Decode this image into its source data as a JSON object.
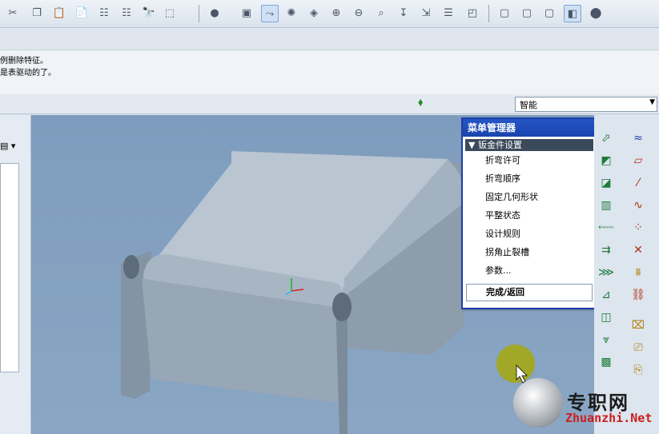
{
  "toolbar": {
    "icons": [
      "cut-icon",
      "copy-icon",
      "paste-icon",
      "paste-special-icon",
      "regenerate-icon",
      "regenerate-manager-icon",
      "find-icon",
      "select-box-icon",
      "shading-icon",
      "view-manager-icon",
      "datum-display-icon",
      "spin-center-icon",
      "orient-icon",
      "zoom-in-icon",
      "zoom-out-icon",
      "refit-icon",
      "reorient-icon",
      "saved-views-icon",
      "layers-icon",
      "appearance-icon",
      "wireframe-icon",
      "hidden-line-icon",
      "no-hidden-icon",
      "shaded-icon",
      "model-tree-icon"
    ]
  },
  "messages": {
    "line1": "例删除特征。",
    "line2": "是表驱动的了。"
  },
  "status": {
    "filter_value": "智能"
  },
  "menu_manager": {
    "title": "菜单管理器",
    "section": "钣金件设置",
    "items": [
      "折弯许可",
      "折弯顺序",
      "固定几何形状",
      "平整状态",
      "设计规则",
      "拐角止裂槽",
      "参数..."
    ],
    "done": "完成/返回"
  },
  "watermark": {
    "cn": "专职网",
    "url": "Zhuanzhi.Net"
  },
  "colors": {
    "menu_border": "#1d3fa8",
    "viewport_bg": "#7e9cbd",
    "model_top": "#b8c5d2",
    "model_side": "#8a99a8"
  }
}
